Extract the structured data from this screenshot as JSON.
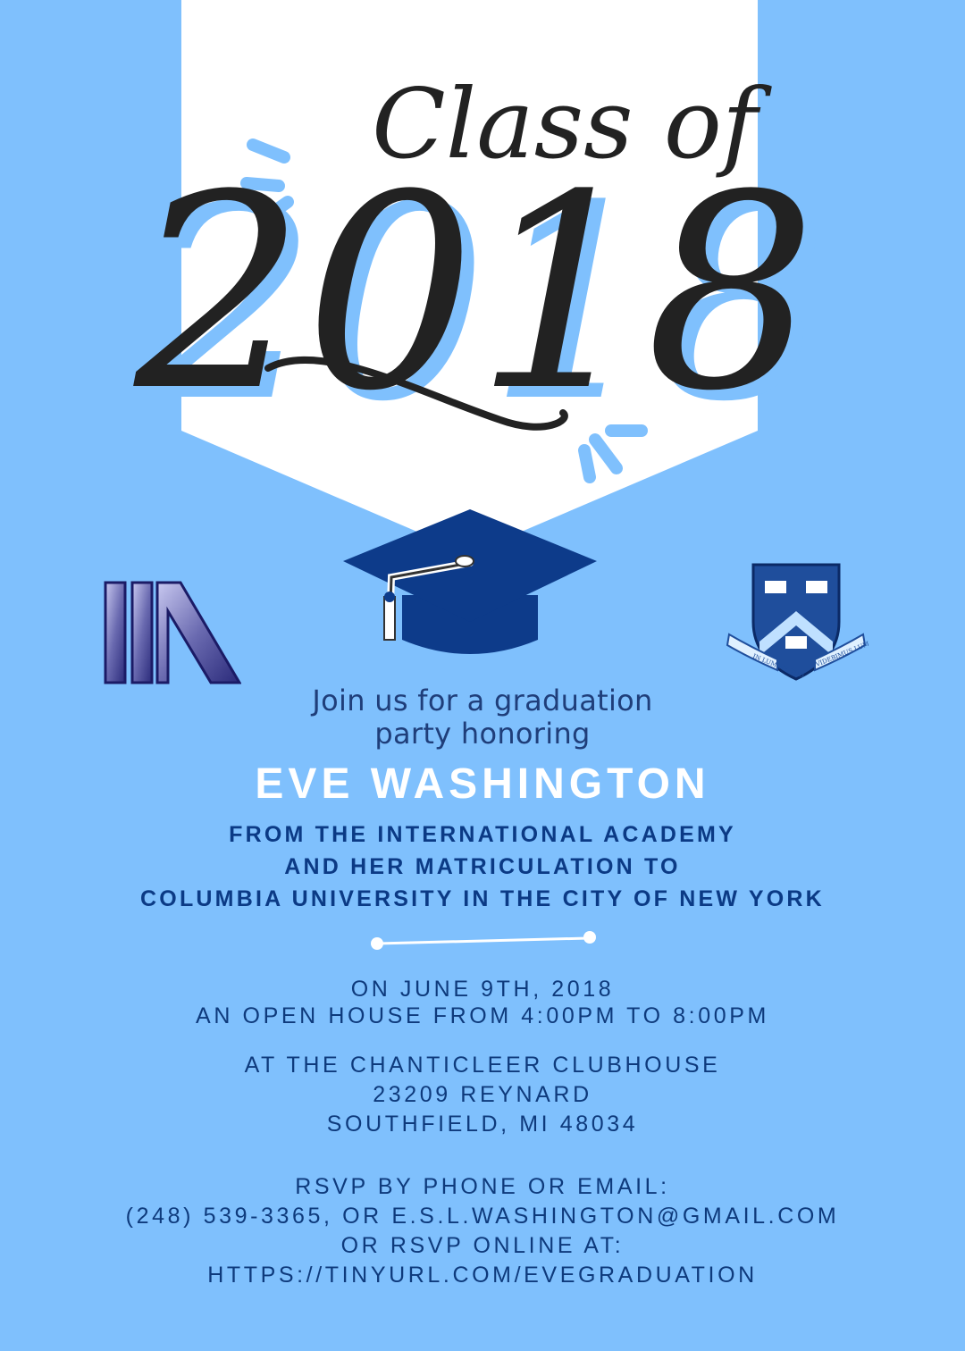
{
  "heading": {
    "class_of": "Class of",
    "year": "2018"
  },
  "invitation": {
    "line1": "Join us for a graduation",
    "line2": "party honoring"
  },
  "honoree": "EVE WASHINGTON",
  "from_lines": [
    "FROM THE INTERNATIONAL ACADEMY",
    "AND HER MATRICULATION TO",
    "COLUMBIA UNIVERSITY IN THE CITY OF NEW YORK"
  ],
  "date_lines": [
    "ON JUNE 9TH, 2018",
    "AN OPEN HOUSE FROM 4:00PM TO 8:00PM"
  ],
  "venue_lines": [
    "AT THE CHANTICLEER CLUBHOUSE",
    "23209 REYNARD",
    "SOUTHFIELD, MI 48034"
  ],
  "rsvp_lines": [
    "RSVP BY PHONE OR EMAIL:",
    "(248) 539-3365, OR E.S.L.WASHINGTON@GMAIL.COM",
    "OR RSVP ONLINE AT:",
    "HTTPS://TINYURL.COM/EVEGRADUATION"
  ],
  "crest_motto": {
    "left": "IN LUMINE TUO",
    "right": "VIDEBIMUS LUMEN"
  },
  "icons": {
    "left_logo": "international-academy-logo",
    "center": "graduation-cap-icon",
    "right_logo": "columbia-crest"
  },
  "colors": {
    "background": "#7fc0fd",
    "banner": "#ffffff",
    "navy": "#0b3a85",
    "cap": "#0d3b8a",
    "script_ink": "#222222",
    "script_shadow": "#7fc0fd"
  }
}
